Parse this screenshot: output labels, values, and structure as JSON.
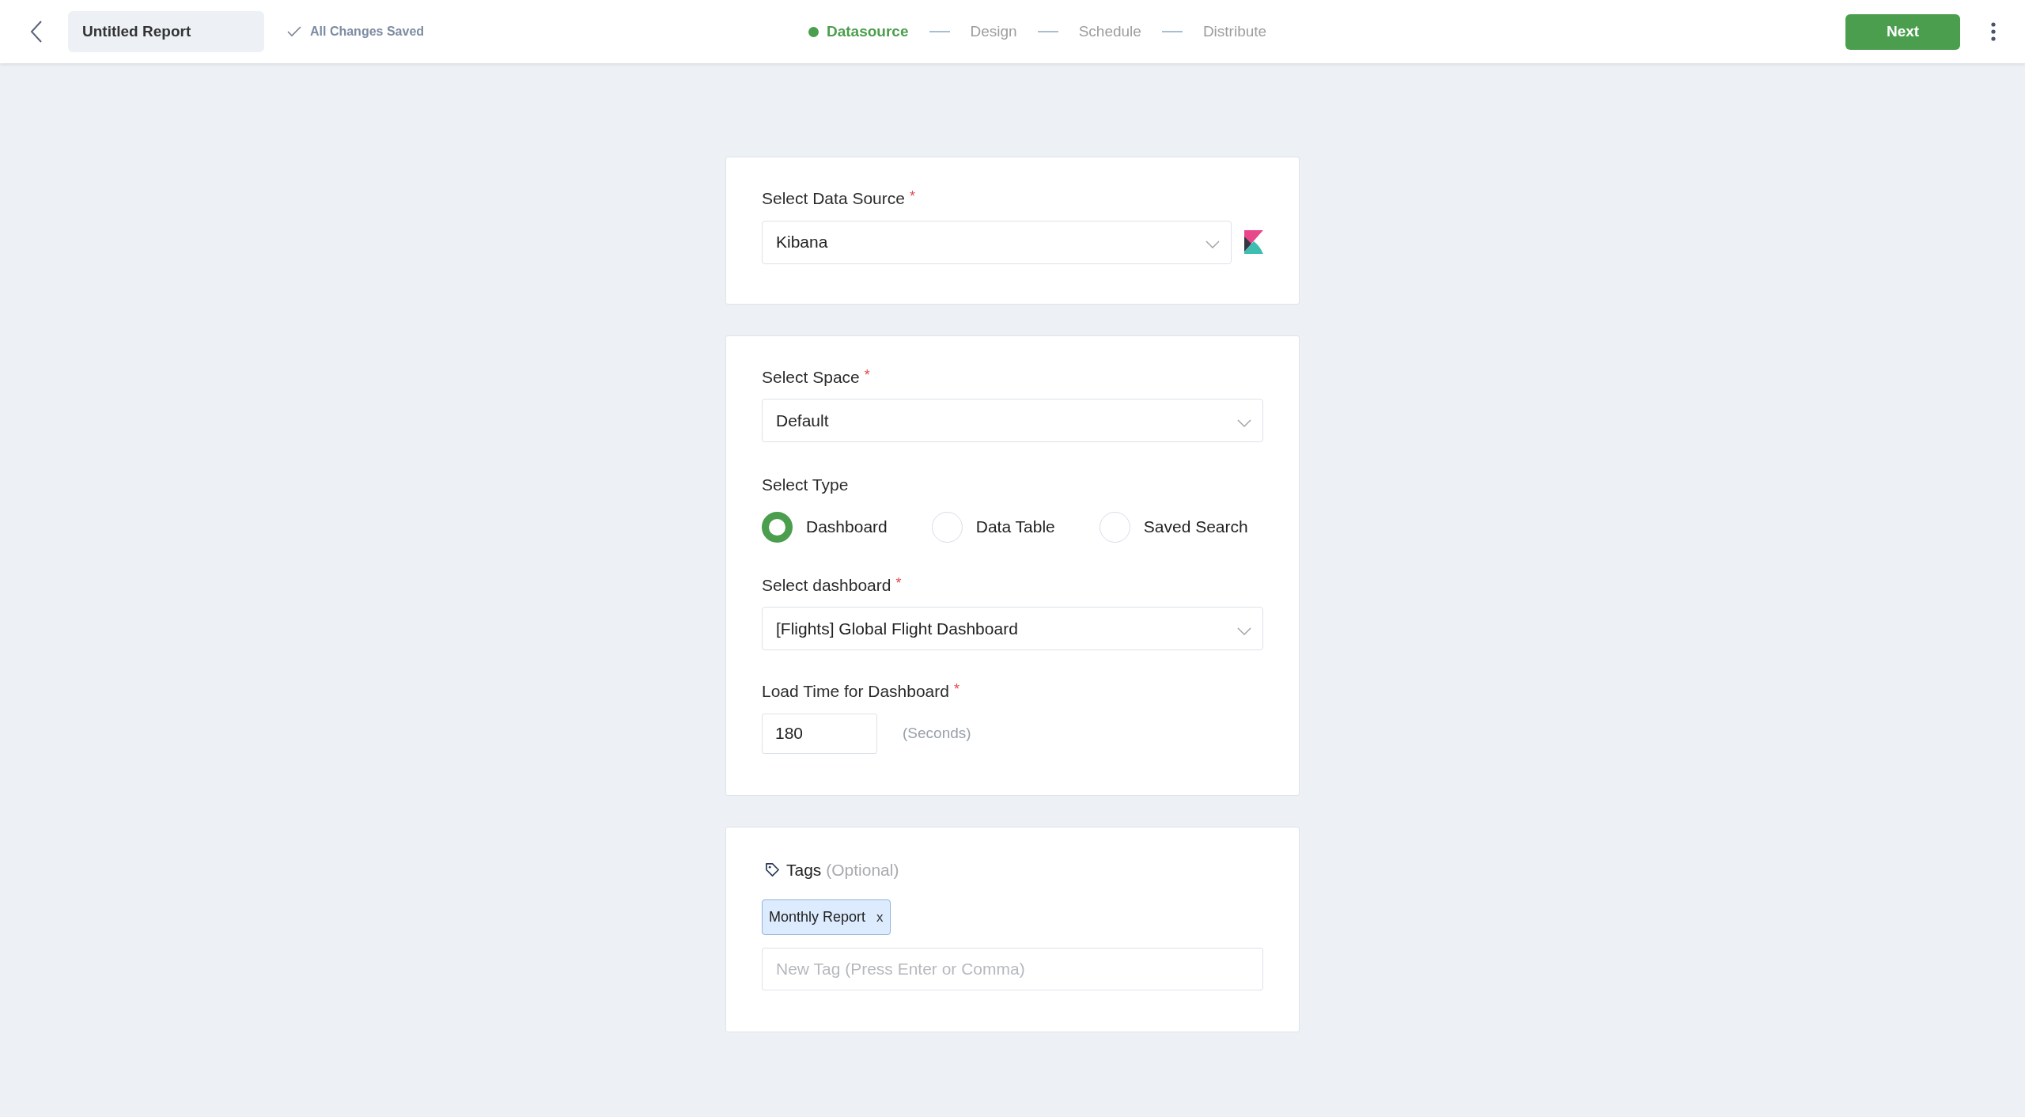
{
  "header": {
    "report_title": "Untitled Report",
    "save_status": "All Changes Saved",
    "steps": [
      {
        "label": "Datasource",
        "selected": true
      },
      {
        "label": "Design",
        "selected": false
      },
      {
        "label": "Schedule",
        "selected": false
      },
      {
        "label": "Distribute",
        "selected": false
      }
    ],
    "next_button": "Next"
  },
  "data_source_card": {
    "label": "Select Data Source",
    "required_mark": "*",
    "value": "Kibana"
  },
  "settings_card": {
    "space": {
      "label": "Select Space",
      "required_mark": "*",
      "value": "Default"
    },
    "type": {
      "label": "Select Type",
      "options": [
        {
          "label": "Dashboard",
          "selected": true
        },
        {
          "label": "Data Table",
          "selected": false
        },
        {
          "label": "Saved Search",
          "selected": false
        }
      ]
    },
    "dashboard": {
      "label": "Select dashboard",
      "required_mark": "*",
      "value": "[Flights] Global Flight Dashboard"
    },
    "load_time": {
      "label": "Load Time for Dashboard",
      "required_mark": "*",
      "value": "180",
      "unit": "(Seconds)"
    }
  },
  "tags_card": {
    "label": "Tags",
    "hint": "(Optional)",
    "tags": [
      {
        "label": "Monthly Report",
        "remove": "x"
      }
    ],
    "placeholder": "New Tag (Press Enter or Comma)"
  }
}
